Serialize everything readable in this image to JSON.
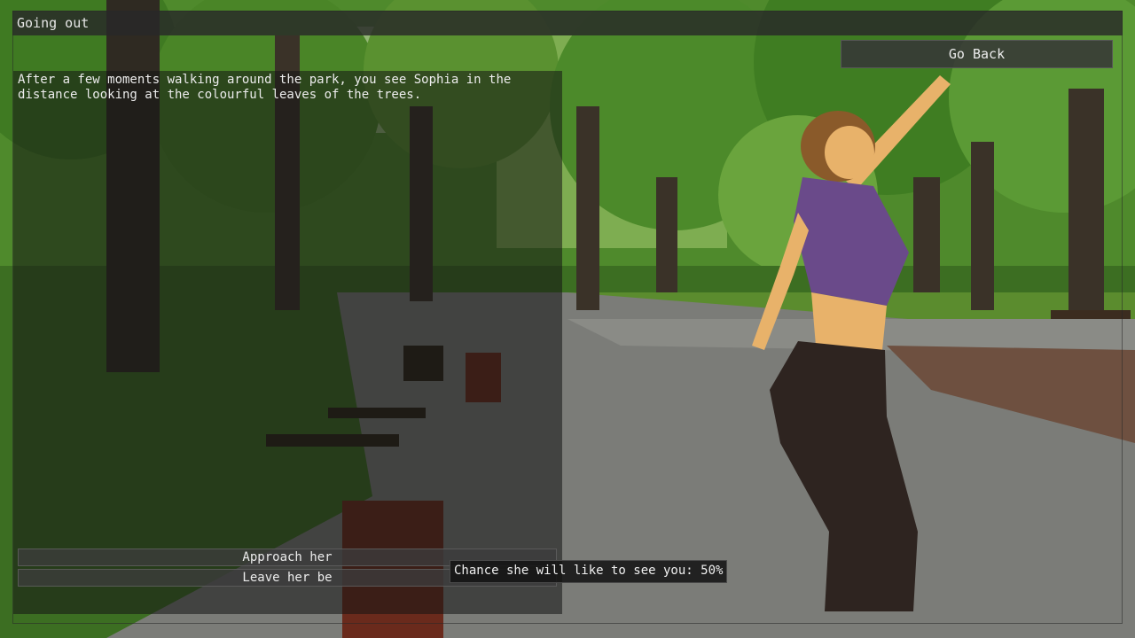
{
  "window": {
    "title": "Going out"
  },
  "nav": {
    "go_back_label": "Go Back"
  },
  "story": {
    "text": "After a few moments walking around the park, you see Sophia in the distance looking at the colourful leaves of the trees."
  },
  "choices": [
    {
      "label": "Approach her"
    },
    {
      "label": "Leave her be"
    }
  ],
  "tooltip": {
    "text": "Chance she will like to see you: 50%"
  },
  "scene": {
    "description_icon": "park-background",
    "character_icon": "sophia-character"
  }
}
